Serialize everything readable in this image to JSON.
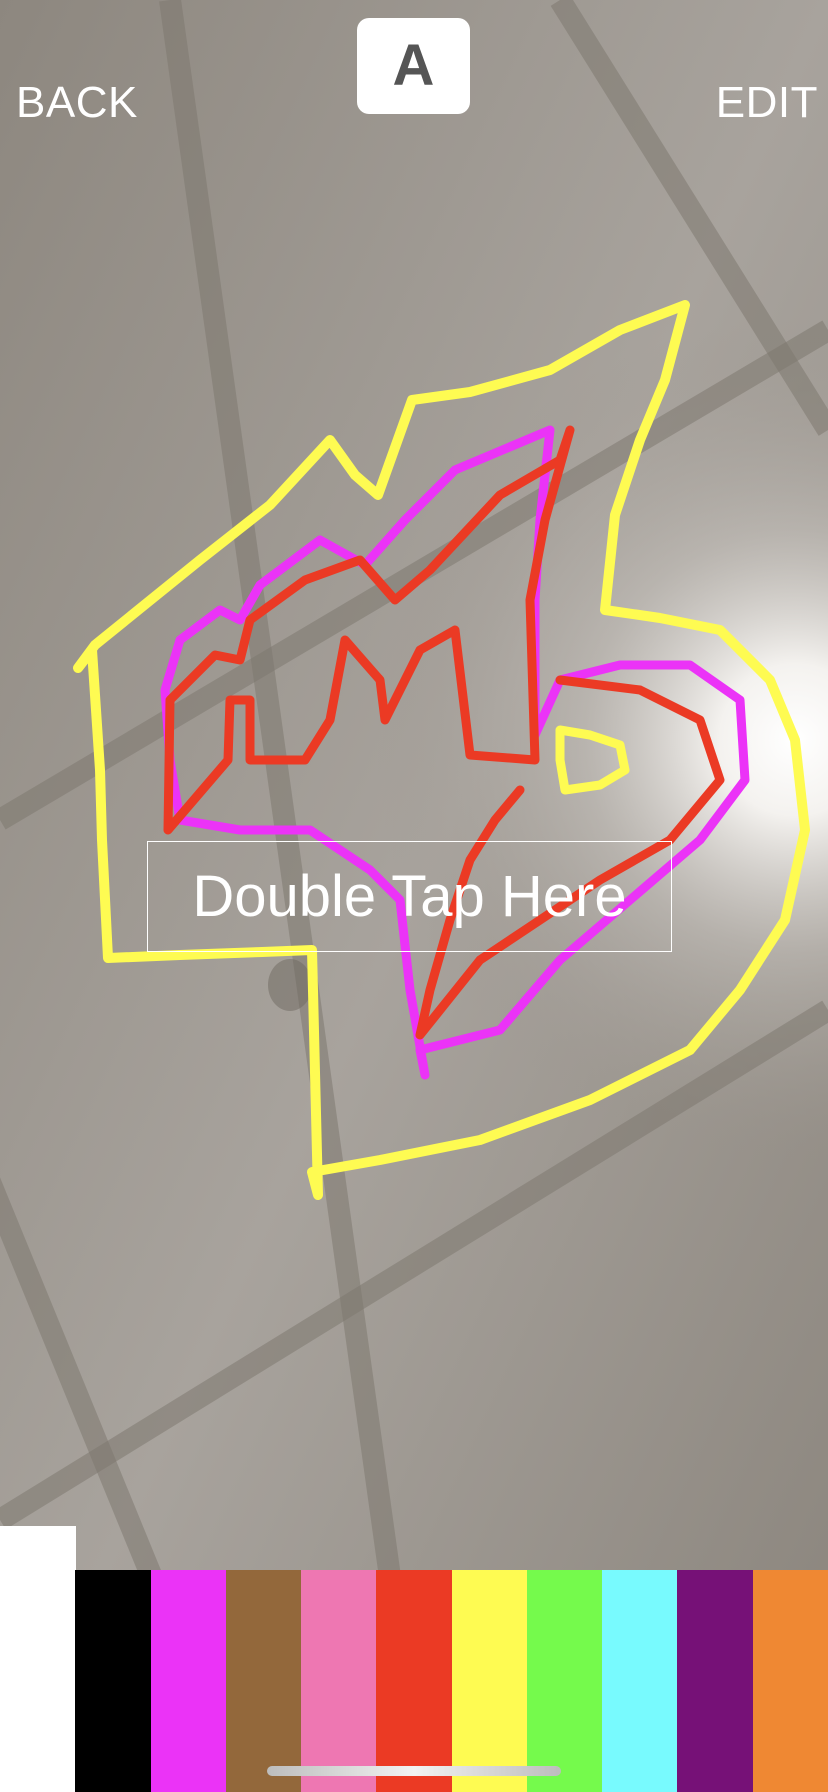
{
  "top_bar": {
    "back_label": "BACK",
    "edit_label": "EDIT",
    "text_tool_label": "A"
  },
  "canvas": {
    "prompt_label": "Double Tap Here"
  },
  "palette": {
    "selected_index": 0,
    "colors": [
      {
        "name": "white",
        "hex": "#ffffff"
      },
      {
        "name": "black",
        "hex": "#000000"
      },
      {
        "name": "magenta",
        "hex": "#eb33f7"
      },
      {
        "name": "brown",
        "hex": "#93683b"
      },
      {
        "name": "pink",
        "hex": "#ee77b2"
      },
      {
        "name": "red",
        "hex": "#eb3a24"
      },
      {
        "name": "yellow",
        "hex": "#fefb52"
      },
      {
        "name": "green",
        "hex": "#75fa4c"
      },
      {
        "name": "cyan",
        "hex": "#78fafe"
      },
      {
        "name": "purple",
        "hex": "#761177"
      },
      {
        "name": "orange",
        "hex": "#ef8833"
      }
    ]
  },
  "stroke_colors": {
    "yellow": "#fefb52",
    "magenta": "#eb33f7",
    "red": "#eb3a24"
  }
}
